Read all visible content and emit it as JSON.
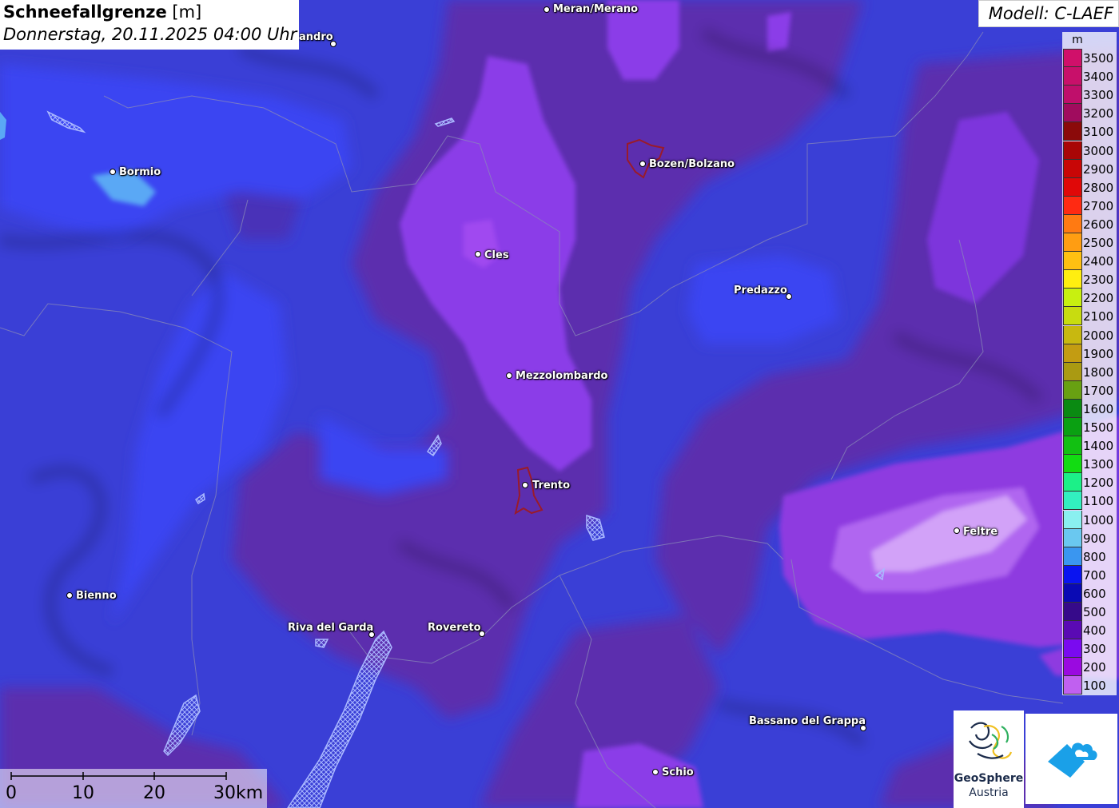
{
  "title": {
    "main": "Schneefallgrenze",
    "unit": "[m]",
    "datetime": "Donnerstag, 20.11.2025 04:00 Uhr"
  },
  "model": "Modell: C-LAEF",
  "legend": {
    "unit": "m",
    "entries": [
      {
        "value": "3500",
        "color": "#d0106a"
      },
      {
        "value": "3400",
        "color": "#c8106a"
      },
      {
        "value": "3300",
        "color": "#bf0f6b"
      },
      {
        "value": "3200",
        "color": "#a00c5e"
      },
      {
        "value": "3100",
        "color": "#8b0a0a"
      },
      {
        "value": "3000",
        "color": "#a80606"
      },
      {
        "value": "2900",
        "color": "#c80606"
      },
      {
        "value": "2800",
        "color": "#e00808"
      },
      {
        "value": "2700",
        "color": "#ff2a12"
      },
      {
        "value": "2600",
        "color": "#ff7a12"
      },
      {
        "value": "2500",
        "color": "#ff9d12"
      },
      {
        "value": "2400",
        "color": "#ffc012"
      },
      {
        "value": "2300",
        "color": "#ffee10"
      },
      {
        "value": "2200",
        "color": "#c8f010"
      },
      {
        "value": "2100",
        "color": "#c8dc10"
      },
      {
        "value": "2000",
        "color": "#c8b810"
      },
      {
        "value": "1900",
        "color": "#c39c12"
      },
      {
        "value": "1800",
        "color": "#aa9a12"
      },
      {
        "value": "1700",
        "color": "#68a012"
      },
      {
        "value": "1600",
        "color": "#0a8a12"
      },
      {
        "value": "1500",
        "color": "#0aa012"
      },
      {
        "value": "1400",
        "color": "#12c012"
      },
      {
        "value": "1300",
        "color": "#12dc12"
      },
      {
        "value": "1200",
        "color": "#1cf088"
      },
      {
        "value": "1100",
        "color": "#32f0c0"
      },
      {
        "value": "1000",
        "color": "#8af0f0"
      },
      {
        "value": "900",
        "color": "#6ac8f0"
      },
      {
        "value": "800",
        "color": "#3a96f0"
      },
      {
        "value": "700",
        "color": "#0a14f0"
      },
      {
        "value": "600",
        "color": "#0a0ab4"
      },
      {
        "value": "500",
        "color": "#360a8a"
      },
      {
        "value": "400",
        "color": "#5a0ab4"
      },
      {
        "value": "300",
        "color": "#7a0af0"
      },
      {
        "value": "200",
        "color": "#9a0ae0"
      },
      {
        "value": "100",
        "color": "#c060f0"
      }
    ]
  },
  "cities": [
    {
      "name": "Meran/Merano",
      "anchor": "left"
    },
    {
      "name": "andro",
      "anchor": "right"
    },
    {
      "name": "Bormio",
      "anchor": "left"
    },
    {
      "name": "Bozen/Bolzano",
      "anchor": "left"
    },
    {
      "name": "Cles",
      "anchor": "left"
    },
    {
      "name": "Predazzo",
      "anchor": "right"
    },
    {
      "name": "Mezzolombardo",
      "anchor": "left"
    },
    {
      "name": "Trento",
      "anchor": "left"
    },
    {
      "name": "Feltre",
      "anchor": "left"
    },
    {
      "name": "Bienno",
      "anchor": "left"
    },
    {
      "name": "Riva del Garda",
      "anchor": "right"
    },
    {
      "name": "Rovereto",
      "anchor": "right"
    },
    {
      "name": "Bassano del Grappa",
      "anchor": "right"
    },
    {
      "name": "Schio",
      "anchor": "left"
    }
  ],
  "scale_bar": {
    "labels": [
      "0",
      "10",
      "20",
      "30km"
    ]
  },
  "logos": {
    "geosphere_line1": "GeoSphere",
    "geosphere_line2": "Austria"
  }
}
